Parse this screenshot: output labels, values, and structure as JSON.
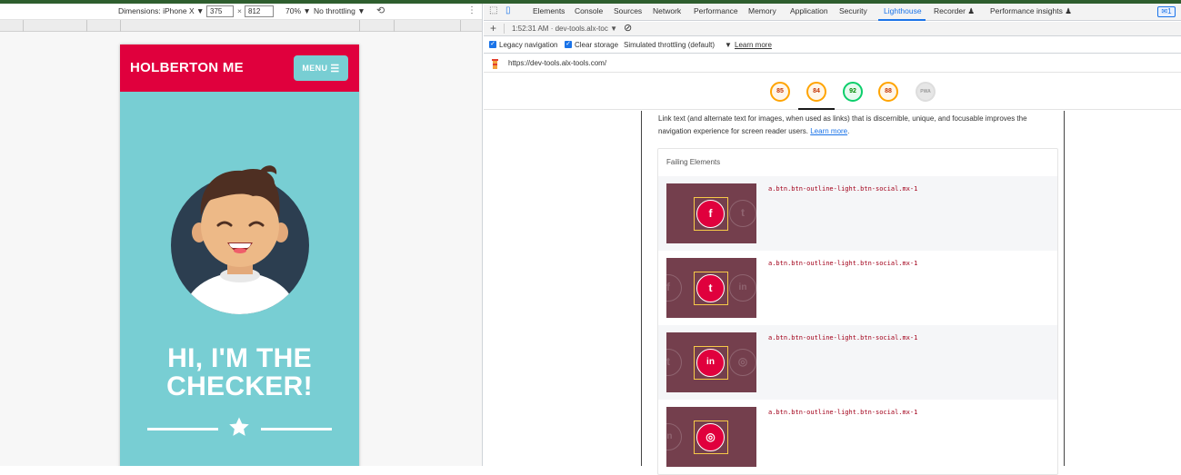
{
  "device_toolbar": {
    "dimensions_label": "Dimensions: iPhone X",
    "width_value": "375",
    "height_value": "812",
    "times": "×",
    "zoom": "70%",
    "throttling": "No throttling",
    "dropdown_arrow": "▼",
    "kebab": "⋮"
  },
  "page": {
    "brand": "HOLBERTON ME",
    "menu_label": "MENU",
    "menu_icon": "☰",
    "hero_title_line1": "HI, I'M THE",
    "hero_title_line2": "CHECKER!"
  },
  "devtools": {
    "tabs": [
      "Elements",
      "Console",
      "Sources",
      "Network",
      "Performance",
      "Memory",
      "Application",
      "Security",
      "Lighthouse",
      "Recorder",
      "Performance insights"
    ],
    "active_tab": "Lighthouse",
    "issues_count": "1",
    "report_selector": "1:52:31 AM · dev-tools.alx-toc",
    "options": {
      "legacy_navigation": "Legacy navigation",
      "clear_storage": "Clear storage",
      "throttling": "Simulated throttling (default)",
      "learn_more": "Learn more"
    },
    "url": "https://dev-tools.alx-tools.com/",
    "scores": [
      "85",
      "84",
      "92",
      "88",
      "PWA"
    ],
    "audit_description": "Link text (and alternate text for images, when used as links) that is discernible, unique, and focusable improves the navigation experience for screen reader users.",
    "audit_learn_more": "Learn more",
    "failing_elements_label": "Failing Elements",
    "failing_rows": [
      {
        "selector": "a.btn.btn-outline-light.btn-social.mx-1",
        "icon": "f"
      },
      {
        "selector": "a.btn.btn-outline-light.btn-social.mx-1",
        "icon": "t"
      },
      {
        "selector": "a.btn.btn-outline-light.btn-social.mx-1",
        "icon": "in"
      },
      {
        "selector": "a.btn.btn-outline-light.btn-social.mx-1",
        "icon": "◎"
      }
    ]
  },
  "colors": {
    "brand_red": "#e0003d",
    "teal": "#78ced3",
    "devtools_blue": "#1a73e8",
    "score_orange": "#ffa400",
    "score_green": "#0cce6b"
  }
}
